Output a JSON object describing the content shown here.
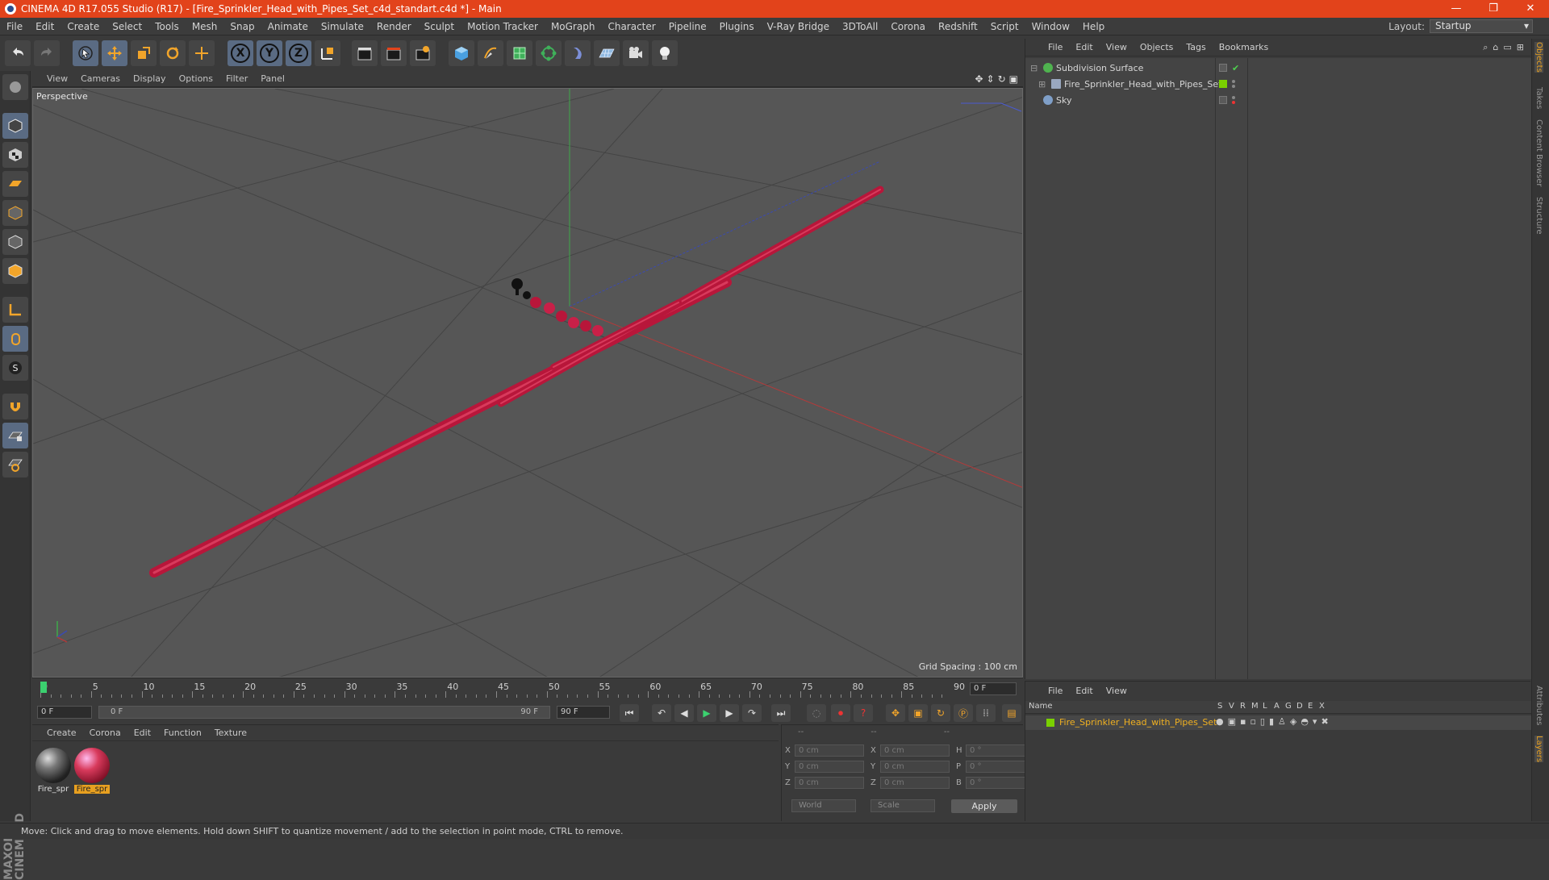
{
  "window": {
    "title": "CINEMA 4D R17.055 Studio (R17) - [Fire_Sprinkler_Head_with_Pipes_Set_c4d_standart.c4d *] - Main",
    "minimize": "—",
    "restore": "❐",
    "close": "✕"
  },
  "menubar": [
    "File",
    "Edit",
    "Create",
    "Select",
    "Tools",
    "Mesh",
    "Snap",
    "Animate",
    "Simulate",
    "Render",
    "Sculpt",
    "Motion Tracker",
    "MoGraph",
    "Character",
    "Pipeline",
    "Plugins",
    "V-Ray Bridge",
    "3DToAll",
    "Corona",
    "Redshift",
    "Script",
    "Window",
    "Help"
  ],
  "layout": {
    "label": "Layout:",
    "value": "Startup"
  },
  "toolbar": {
    "x_label": "X",
    "y_label": "Y",
    "z_label": "Z"
  },
  "viewport": {
    "menu": [
      "View",
      "Cameras",
      "Display",
      "Options",
      "Filter",
      "Panel"
    ],
    "camera": "Perspective",
    "grid_spacing": "Grid Spacing : 100 cm"
  },
  "timeline": {
    "ticks": [
      "0",
      "5",
      "10",
      "15",
      "20",
      "25",
      "30",
      "35",
      "40",
      "45",
      "50",
      "55",
      "60",
      "65",
      "70",
      "75",
      "80",
      "85",
      "90"
    ],
    "current_frame": "0 F"
  },
  "transport": {
    "start": "0 F",
    "range_start": "0 F",
    "range_end": "90 F",
    "end": "90 F"
  },
  "materials": {
    "menu": [
      "Create",
      "Corona",
      "Edit",
      "Function",
      "Texture"
    ],
    "items": [
      {
        "label": "Fire_spr",
        "selected": false
      },
      {
        "label": "Fire_spr",
        "selected": true
      }
    ]
  },
  "coords": {
    "header": [
      "--",
      "--",
      "--"
    ],
    "rows": [
      {
        "a": "X",
        "av": "0 cm",
        "b": "X",
        "bv": "0 cm",
        "c": "H",
        "cv": "0 °"
      },
      {
        "a": "Y",
        "av": "0 cm",
        "b": "Y",
        "bv": "0 cm",
        "c": "P",
        "cv": "0 °"
      },
      {
        "a": "Z",
        "av": "0 cm",
        "b": "Z",
        "bv": "0 cm",
        "c": "B",
        "cv": "0 °"
      }
    ],
    "world": "World",
    "scale": "Scale",
    "apply": "Apply"
  },
  "objects": {
    "menu": [
      "File",
      "Edit",
      "View",
      "Objects",
      "Tags",
      "Bookmarks"
    ],
    "items": [
      {
        "name": "Subdivision Surface",
        "icon_color": "#4fb34f"
      },
      {
        "name": "Fire_Sprinkler_Head_with_Pipes_Set",
        "icon_color": "#9aa8c0"
      },
      {
        "name": "Sky",
        "icon_color": "#7f9fc8"
      }
    ]
  },
  "side_tabs": [
    "Objects",
    "Takes",
    "Content Browser",
    "Structure"
  ],
  "side_tabs_bottom": [
    "Attributes",
    "Layers"
  ],
  "layers": {
    "menu": [
      "File",
      "Edit",
      "View"
    ],
    "columns": [
      "Name",
      "S",
      "V",
      "R",
      "M",
      "L",
      "A",
      "G",
      "D",
      "E",
      "X"
    ],
    "row": "Fire_Sprinkler_Head_with_Pipes_Set"
  },
  "status": "Move: Click and drag to move elements. Hold down SHIFT to quantize movement / add to the selection in point mode, CTRL to remove.",
  "colors": {
    "accent": "#e2431b",
    "pipe": "#b8163a",
    "selected": "#e8a020"
  }
}
